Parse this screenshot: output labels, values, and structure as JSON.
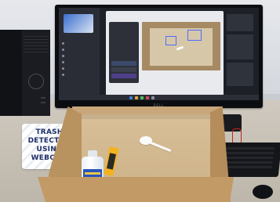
{
  "sign": {
    "line1": "TRASH",
    "line2": "DETECTOR",
    "line3": "USING",
    "line4": "WEBCAM"
  },
  "monitor": {
    "brand": "DELL"
  },
  "colors": {
    "detection_box": "#4d6bff",
    "box_cardboard": "#c8a77a",
    "bottle_label": "#2a55b8",
    "packet": "#f3b21f"
  }
}
